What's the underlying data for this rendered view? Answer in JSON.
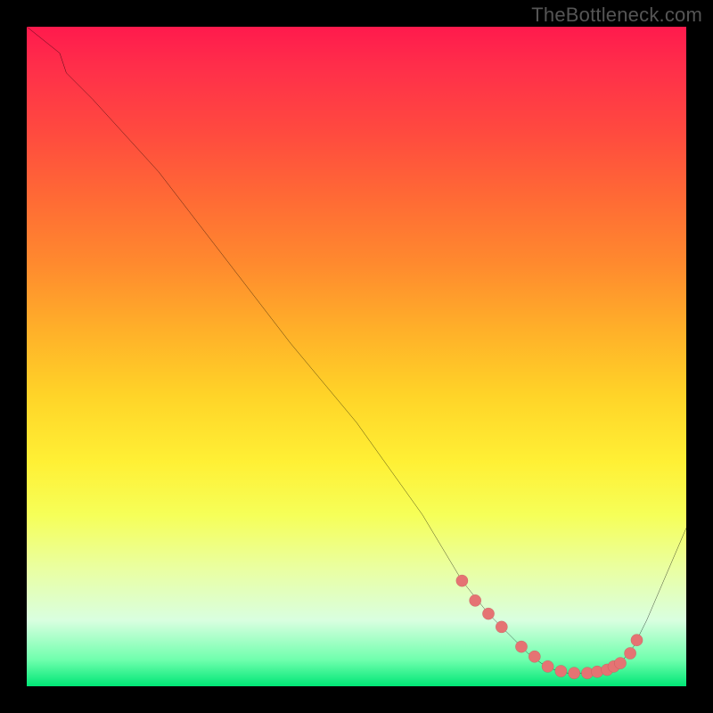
{
  "watermark": "TheBottleneck.com",
  "chart_data": {
    "type": "line",
    "title": "",
    "xlabel": "",
    "ylabel": "",
    "xlim": [
      0,
      100
    ],
    "ylim": [
      0,
      100
    ],
    "series": [
      {
        "name": "curve",
        "x": [
          0,
          5,
          6,
          10,
          20,
          30,
          40,
          50,
          60,
          66,
          70,
          72,
          74,
          76,
          78,
          80,
          82,
          84,
          86,
          88,
          90,
          92,
          94,
          100
        ],
        "y": [
          100,
          96,
          93,
          89,
          78,
          65,
          52,
          40,
          26,
          16,
          11,
          9,
          7,
          5,
          3.5,
          2.5,
          2,
          2,
          2,
          2.5,
          3.5,
          6,
          10,
          24
        ]
      }
    ],
    "markers": {
      "name": "dots",
      "x": [
        66,
        68,
        70,
        72,
        75,
        77,
        79,
        81,
        83,
        85,
        86.5,
        88,
        89,
        90,
        91.5,
        92.5
      ],
      "y": [
        16,
        13,
        11,
        9,
        6,
        4.5,
        3,
        2.3,
        2,
        2,
        2.2,
        2.5,
        3,
        3.5,
        5,
        7
      ]
    },
    "gradient_stops": [
      {
        "pct": 0,
        "color": "#ff1a4d"
      },
      {
        "pct": 6,
        "color": "#ff2e4a"
      },
      {
        "pct": 16,
        "color": "#ff4a3f"
      },
      {
        "pct": 26,
        "color": "#ff6a35"
      },
      {
        "pct": 36,
        "color": "#ff8a2e"
      },
      {
        "pct": 46,
        "color": "#ffb029"
      },
      {
        "pct": 56,
        "color": "#ffd428"
      },
      {
        "pct": 66,
        "color": "#fff035"
      },
      {
        "pct": 74,
        "color": "#f6ff58"
      },
      {
        "pct": 82,
        "color": "#eaffa0"
      },
      {
        "pct": 90,
        "color": "#d9ffe0"
      },
      {
        "pct": 96,
        "color": "#6fffad"
      },
      {
        "pct": 100,
        "color": "#00e676"
      }
    ],
    "colors": {
      "curve": "#000000",
      "marker_fill": "#e57373",
      "marker_stroke": "#8a2f2f",
      "frame": "#000000"
    }
  }
}
